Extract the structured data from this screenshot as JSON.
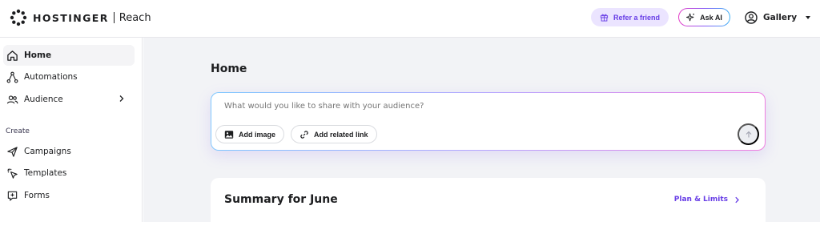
{
  "header": {
    "brand": "HOSTINGER",
    "product": "Reach",
    "refer_label": "Refer a friend",
    "ask_ai_label": "Ask AI",
    "account_label": "Gallery"
  },
  "sidebar": {
    "items": [
      {
        "label": "Home",
        "icon": "home-icon",
        "active": true
      },
      {
        "label": "Automations",
        "icon": "automation-icon"
      },
      {
        "label": "Audience",
        "icon": "users-icon"
      }
    ],
    "section_create": "Create",
    "create_items": [
      {
        "label": "Campaigns",
        "icon": "send-icon"
      },
      {
        "label": "Templates",
        "icon": "cursor-click-icon"
      },
      {
        "label": "Forms",
        "icon": "form-icon"
      }
    ]
  },
  "main": {
    "title": "Home",
    "composer": {
      "placeholder": "What would you like to share with your audience?",
      "add_image_label": "Add image",
      "add_link_label": "Add related link"
    },
    "summary": {
      "title": "Summary for June",
      "plan_link": "Plan & Limits"
    }
  },
  "colors": {
    "accent": "#673de6",
    "accent_soft": "#ebe4ff",
    "background": "#f2f3f6"
  }
}
